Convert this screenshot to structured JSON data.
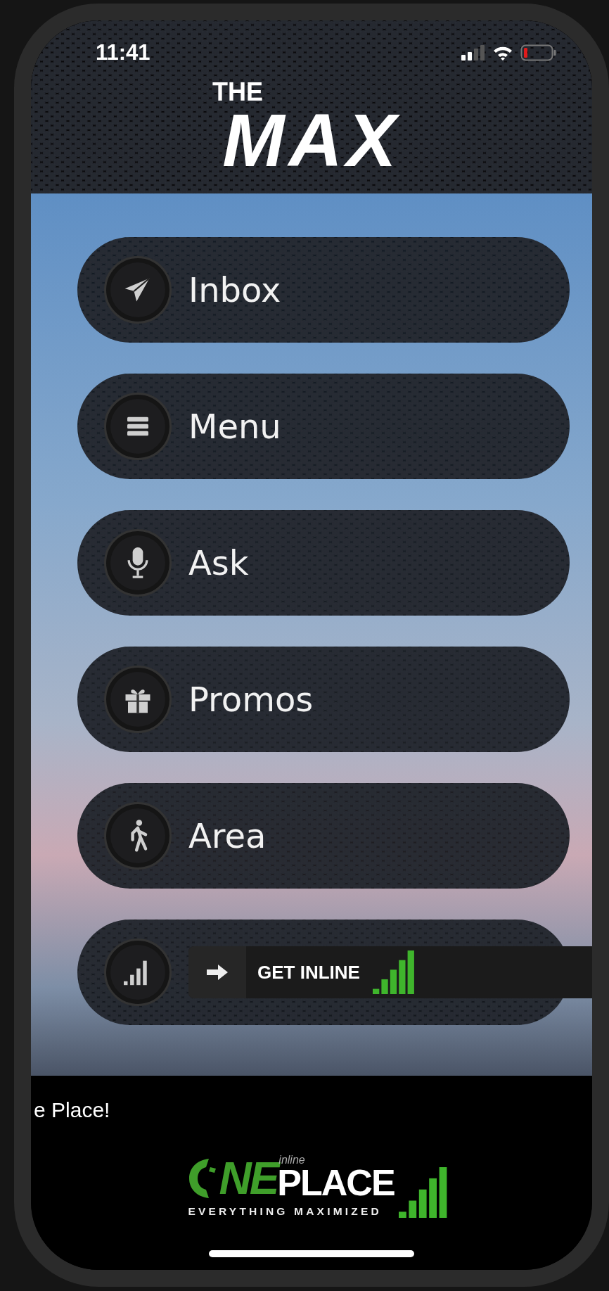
{
  "status_bar": {
    "time": "11:41"
  },
  "logo": {
    "top": "THE",
    "main": "MAX"
  },
  "menu": [
    {
      "kind": "plane",
      "label": "Inbox"
    },
    {
      "kind": "lines",
      "label": "Menu"
    },
    {
      "kind": "mic",
      "label": "Ask"
    },
    {
      "kind": "gift",
      "label": "Promos"
    },
    {
      "kind": "walk",
      "label": "Area"
    },
    {
      "kind": "signal",
      "label": "GET INLINE"
    }
  ],
  "ticker": "e Place!",
  "footer_logo": {
    "letters": "NE",
    "small": "inline",
    "word": "PLACE",
    "tagline": "EVERYTHING MAXIMIZED"
  }
}
